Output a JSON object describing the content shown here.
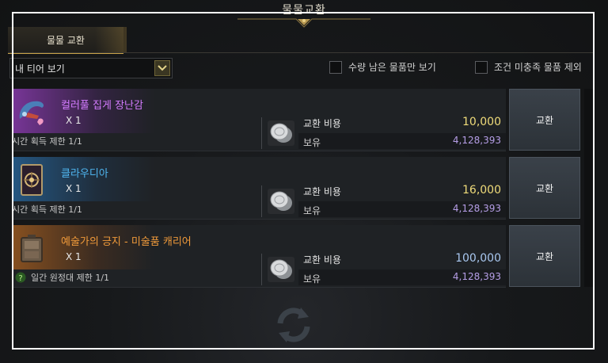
{
  "window": {
    "title": "물물교환"
  },
  "tabs": [
    {
      "label": "물물 교환",
      "active": true
    }
  ],
  "filter": {
    "dropdown_value": "내 티어 보기",
    "checkbox_remaining": "수량 남은 물품만 보기",
    "checkbox_unmet": "조건 미충족 물품 제외"
  },
  "items": [
    {
      "name": "컬러풀 집게 장난감",
      "name_color": "#d47bff",
      "quantity": "X 1",
      "limit": "시간 획득 제한 1/1",
      "cost_label": "교환 비용",
      "cost": "10,000",
      "cost_color": "#f0dc7a",
      "own_label": "보유",
      "own": "4,128,393",
      "button": "교환",
      "icon": "claw-toy-icon"
    },
    {
      "name": "클라우디아",
      "name_color": "#4fb6f0",
      "quantity": "X 1",
      "limit": "시간 획득 제한 1/1",
      "cost_label": "교환 비용",
      "cost": "16,000",
      "cost_color": "#f0dc7a",
      "own_label": "보유",
      "own": "4,128,393",
      "button": "교환",
      "icon": "card-icon"
    },
    {
      "name": "예술가의 긍지 - 미술품 캐리어",
      "name_color": "#f09a3a",
      "quantity": "X 1",
      "limit": "일간 원정대 제한 1/1",
      "cost_label": "교환 비용",
      "cost": "100,000",
      "cost_color": "#a9c8f0",
      "own_label": "보유",
      "own": "4,128,393",
      "button": "교환",
      "icon": "carrier-icon"
    }
  ]
}
